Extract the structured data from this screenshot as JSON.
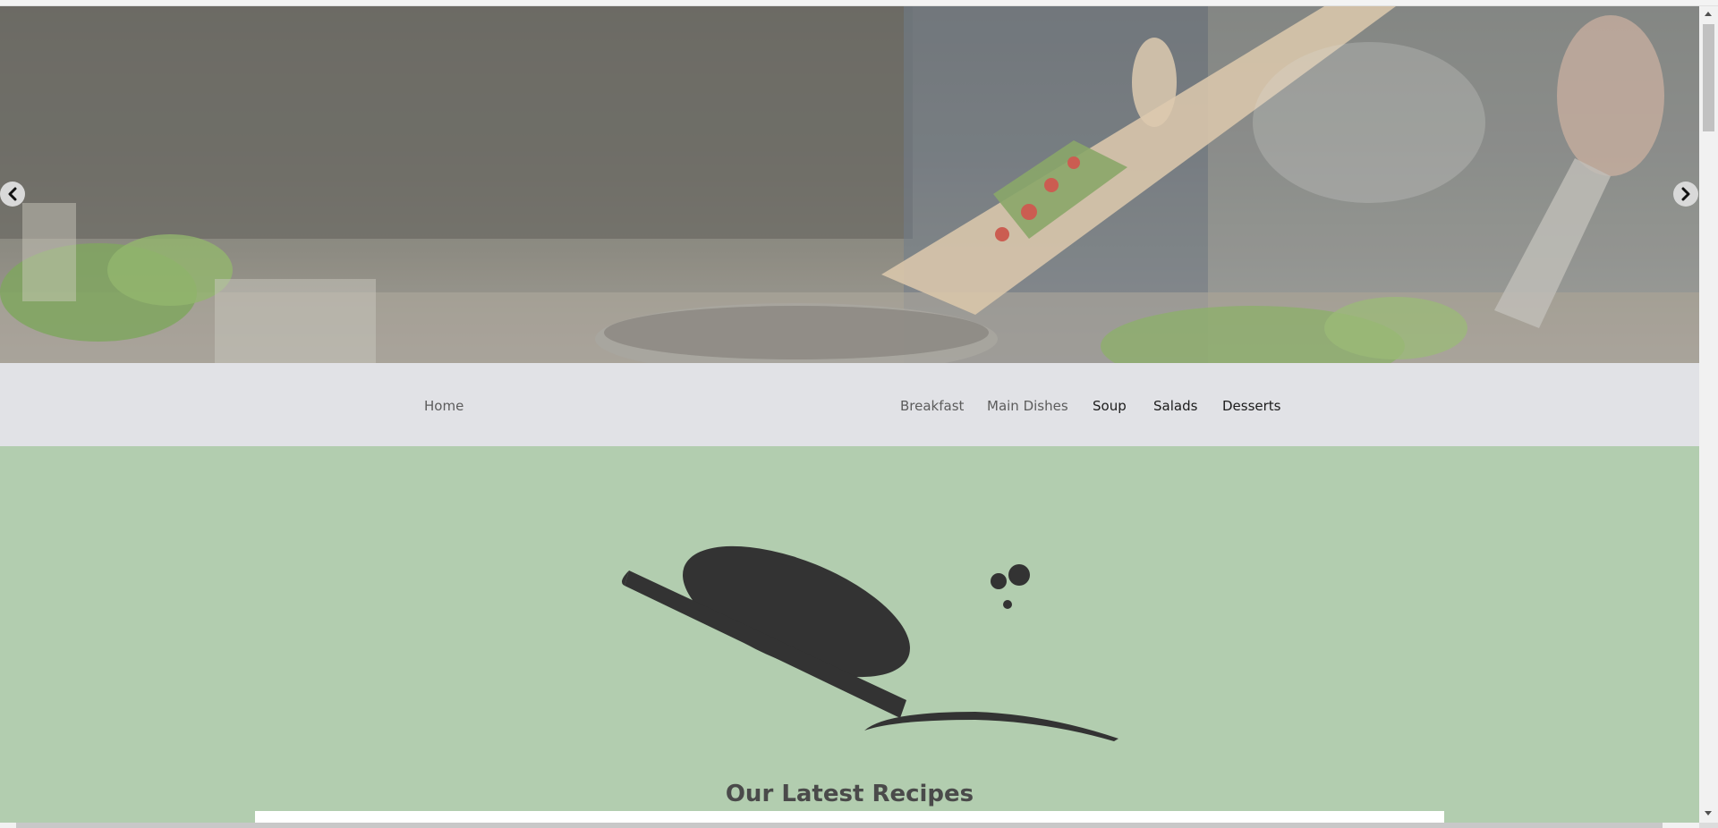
{
  "colors": {
    "navbar_bg": "#e1e2e6",
    "section_bg": "#b2cdaf",
    "logo_color": "#333333",
    "title_color": "#4a4a4a"
  },
  "carousel": {
    "prev_icon": "chevron-left-icon",
    "next_icon": "chevron-right-icon"
  },
  "nav": {
    "home": "Home",
    "items": [
      "Breakfast",
      "Main Dishes",
      "Soup",
      "Salads",
      "Desserts"
    ]
  },
  "latest": {
    "title": "Our Latest Recipes"
  }
}
